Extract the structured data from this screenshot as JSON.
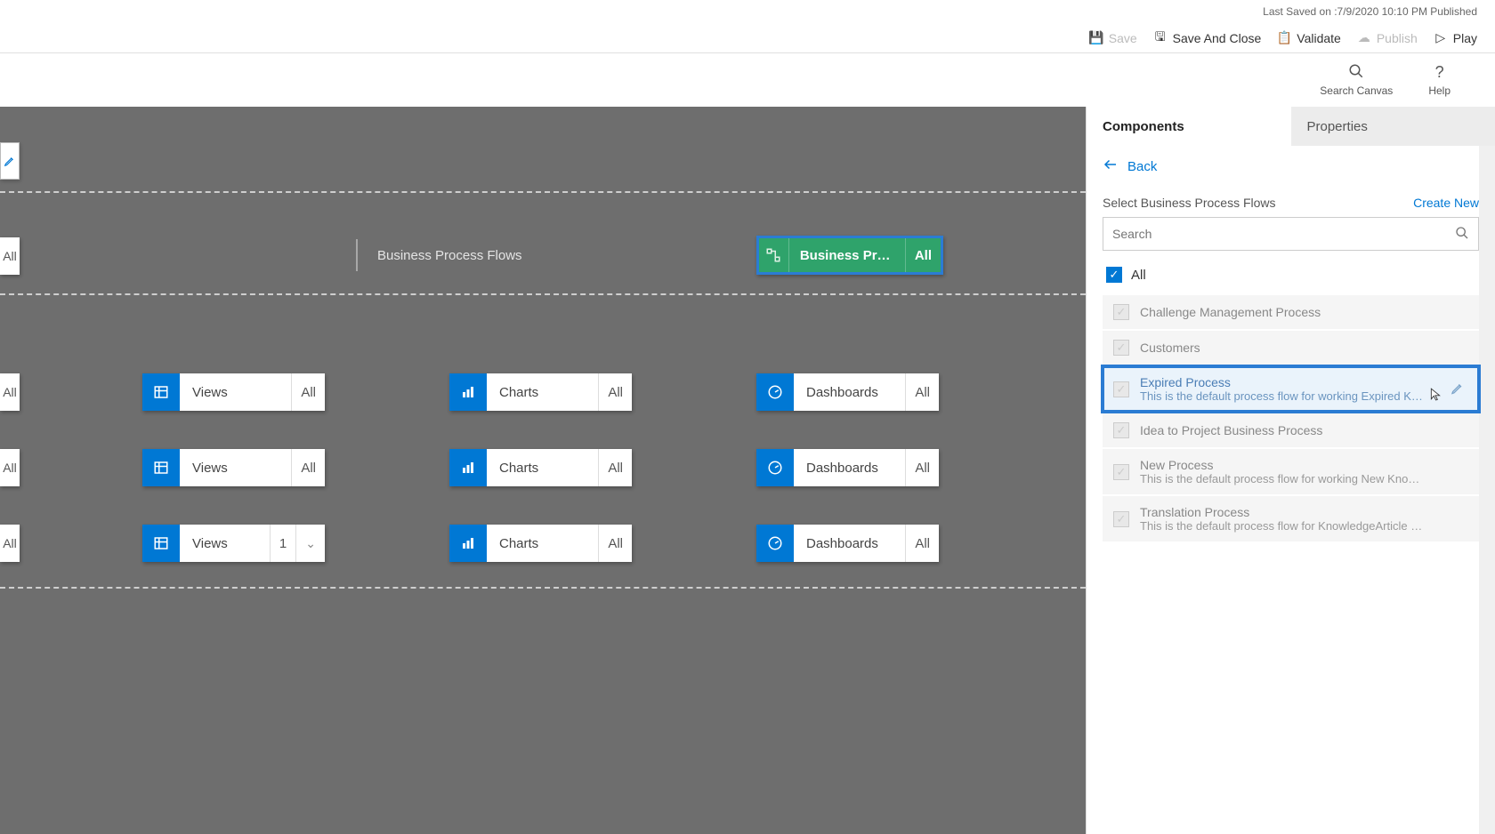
{
  "status_bar": {
    "last_saved": "Last Saved on :7/9/2020 10:10 PM Published"
  },
  "toolbar": {
    "save": "Save",
    "save_close": "Save And Close",
    "validate": "Validate",
    "publish": "Publish",
    "play": "Play"
  },
  "secondary": {
    "search_canvas": "Search Canvas",
    "help": "Help"
  },
  "panel": {
    "tabs": {
      "components": "Components",
      "properties": "Properties"
    },
    "back": "Back",
    "section_title": "Select Business Process Flows",
    "create_new": "Create New",
    "search_placeholder": "Search",
    "all_label": "All",
    "flows": [
      {
        "title": "Challenge Management Process",
        "desc": ""
      },
      {
        "title": "Customers",
        "desc": ""
      },
      {
        "title": "Expired Process",
        "desc": "This is the default process flow for working Expired K…"
      },
      {
        "title": "Idea to Project Business Process",
        "desc": ""
      },
      {
        "title": "New Process",
        "desc": "This is the default process flow for working New Kno…"
      },
      {
        "title": "Translation Process",
        "desc": "This is the default process flow for KnowledgeArticle …"
      }
    ]
  },
  "canvas": {
    "bpf_label": "Business Process Flows",
    "green_tile": {
      "label": "Business Proces…",
      "badge": "All"
    },
    "edge_badge": "All",
    "views": "Views",
    "charts": "Charts",
    "dashboards": "Dashboards",
    "all": "All",
    "one": "1"
  }
}
